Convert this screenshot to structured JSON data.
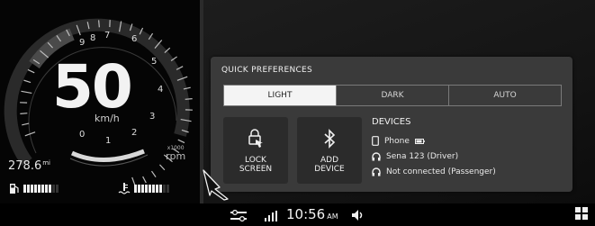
{
  "cluster": {
    "speed": "50",
    "speed_unit": "km/h",
    "odometer_value": "278.6",
    "odometer_unit": "mi",
    "rpm_multiplier": "x1000",
    "rpm_label": "rpm",
    "tach_numbers": [
      "0",
      "1",
      "2",
      "3",
      "4",
      "5",
      "6",
      "7",
      "8",
      "9"
    ],
    "fuel_level": 0.8,
    "temp_level": 0.8
  },
  "quick_prefs": {
    "title": "QUICK PREFERENCES",
    "modes": [
      "LIGHT",
      "DARK",
      "AUTO"
    ],
    "active_mode": "LIGHT",
    "lock_label_1": "LOCK",
    "lock_label_2": "SCREEN",
    "add_label_1": "ADD",
    "add_label_2": "DEVICE",
    "devices_title": "DEVICES",
    "devices": [
      {
        "name": "Phone",
        "icon": "phone-icon"
      },
      {
        "name": "Sena 123 (Driver)",
        "icon": "headset-icon"
      },
      {
        "name": "Not connected (Passenger)",
        "icon": "headset-icon"
      }
    ]
  },
  "status_bar": {
    "time": "10:56",
    "ampm": "AM"
  },
  "colors": {
    "panel": "#3a3a3a",
    "tile": "#2b2b2b",
    "active": "#f4f4f4",
    "bg": "#000000"
  }
}
